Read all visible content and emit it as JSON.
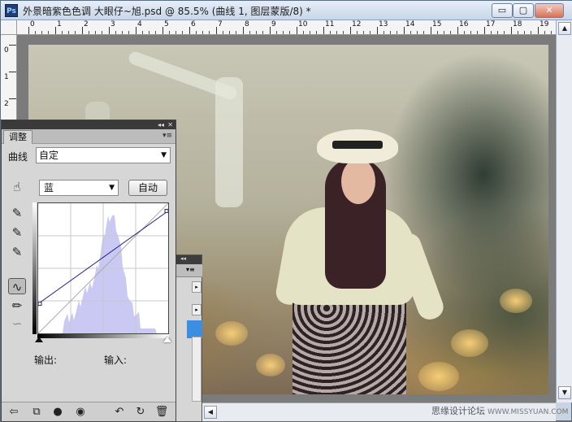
{
  "window": {
    "app_badge": "Ps",
    "title": "外景暗紫色色调 大眼仔~旭.psd @ 85.5% (曲线 1, 图层蒙版/8) *",
    "minimize_label": "▭",
    "restore_label": "▢",
    "close_label": "✕"
  },
  "rulers": {
    "top_numbers": [
      "0",
      "1",
      "2",
      "3",
      "4",
      "5",
      "6",
      "7",
      "8",
      "9",
      "10",
      "11",
      "12",
      "13",
      "14",
      "15",
      "16",
      "17",
      "18",
      "19"
    ],
    "left_numbers": [
      "0",
      "1",
      "2"
    ]
  },
  "adjustments": {
    "tab_label": "调整",
    "collapse_glyph": "◂◂",
    "close_glyph": "✕",
    "menu_glyph": "▾≡",
    "preset_label": "曲线",
    "preset_value": "自定",
    "channel_value": "蓝",
    "auto_label": "自动",
    "output_label": "输出:",
    "input_label": "输入:",
    "curve_points": [
      [
        0,
        58
      ],
      [
        255,
        240
      ]
    ],
    "curve_color": "#23238f",
    "histogram_color": "#c9c9f4"
  },
  "layers_panel": {
    "collapse_glyph": "◂◂",
    "menu_glyph": "▾≡"
  },
  "watermark": {
    "text": "思缘设计论坛",
    "site": "WWW.MISSYUAN.COM"
  }
}
